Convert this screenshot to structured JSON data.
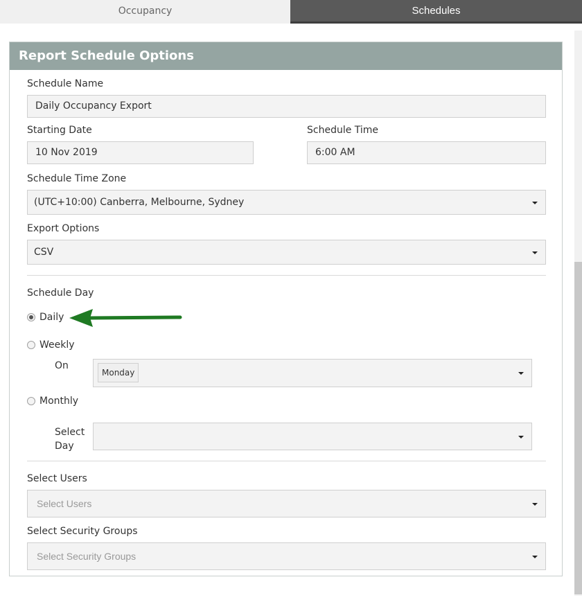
{
  "tabs": {
    "occupancy": "Occupancy",
    "schedules": "Schedules"
  },
  "panel": {
    "title": "Report Schedule Options"
  },
  "schedule_name": {
    "label": "Schedule Name",
    "value": "Daily Occupancy Export"
  },
  "starting_date": {
    "label": "Starting Date",
    "value": "10 Nov 2019"
  },
  "schedule_time": {
    "label": "Schedule Time",
    "value": "6:00 AM"
  },
  "time_zone": {
    "label": "Schedule Time Zone",
    "value": "(UTC+10:00) Canberra, Melbourne, Sydney"
  },
  "export_options": {
    "label": "Export Options",
    "value": "CSV"
  },
  "schedule_day": {
    "label": "Schedule Day",
    "daily": "Daily",
    "weekly": "Weekly",
    "on_label": "On",
    "weekly_value": "Monday",
    "monthly": "Monthly",
    "select_day_line1": "Select",
    "select_day_line2": "Day",
    "selected": "Daily"
  },
  "select_users": {
    "label": "Select Users",
    "placeholder": "Select Users"
  },
  "security_groups": {
    "label": "Select Security Groups",
    "placeholder": "Select Security Groups"
  },
  "colors": {
    "header_bg": "#95a5a2",
    "active_tab_bg": "#5a5a5a",
    "arrow": "#1f7a23"
  }
}
